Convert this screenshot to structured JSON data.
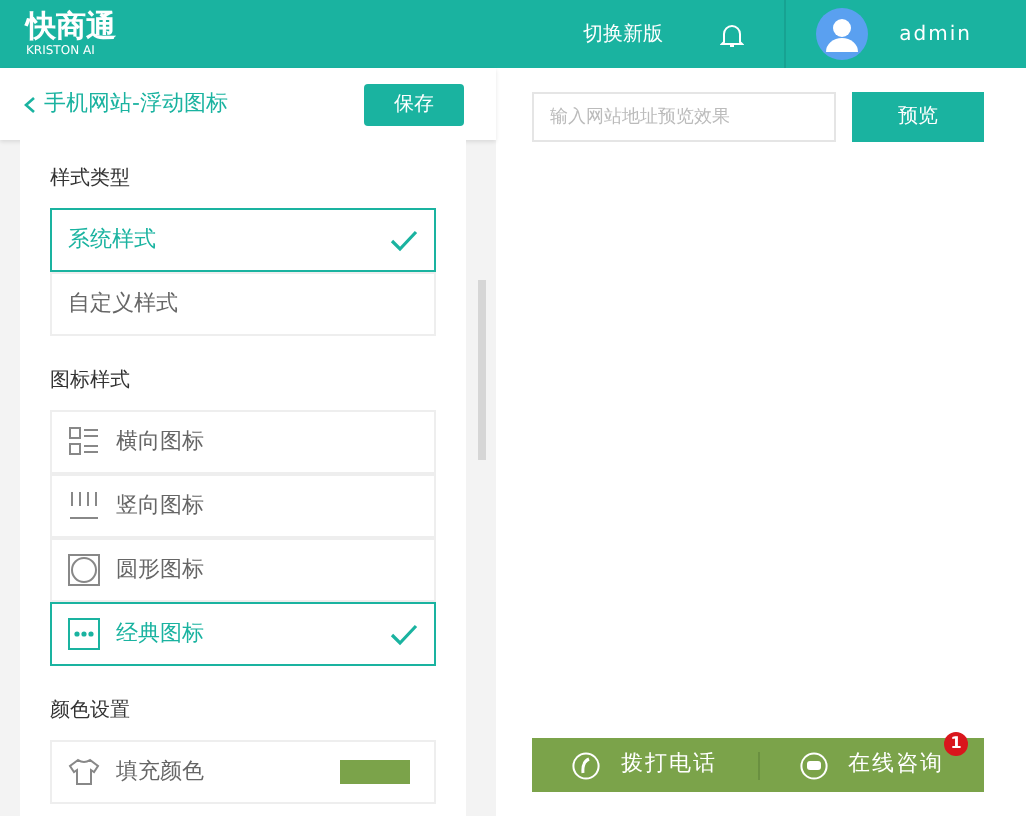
{
  "header": {
    "logo": "快商通",
    "logo_sub": "KRISTON AI",
    "switch_label": "切换新版",
    "user": "admin"
  },
  "toolbar": {
    "back_title": "手机网站-浮动图标",
    "save": "保存"
  },
  "preview_bar": {
    "placeholder": "输入网站地址预览效果",
    "button": "预览"
  },
  "style_type": {
    "title": "样式类型",
    "options": [
      {
        "label": "系统样式",
        "selected": true
      },
      {
        "label": "自定义样式",
        "selected": false
      }
    ]
  },
  "icon_style": {
    "title": "图标样式",
    "options": [
      {
        "kind": "horizontal",
        "label": "横向图标",
        "selected": false
      },
      {
        "kind": "vertical",
        "label": "竖向图标",
        "selected": false
      },
      {
        "kind": "circle",
        "label": "圆形图标",
        "selected": false
      },
      {
        "kind": "classic",
        "label": "经典图标",
        "selected": true
      }
    ]
  },
  "color_setting": {
    "title": "颜色设置",
    "fill_label": "填充颜色",
    "color": "#7ba34a"
  },
  "preview_widget": {
    "color": "#7ba34a",
    "call": "拨打电话",
    "consult": "在线咨询",
    "badge": "1"
  }
}
